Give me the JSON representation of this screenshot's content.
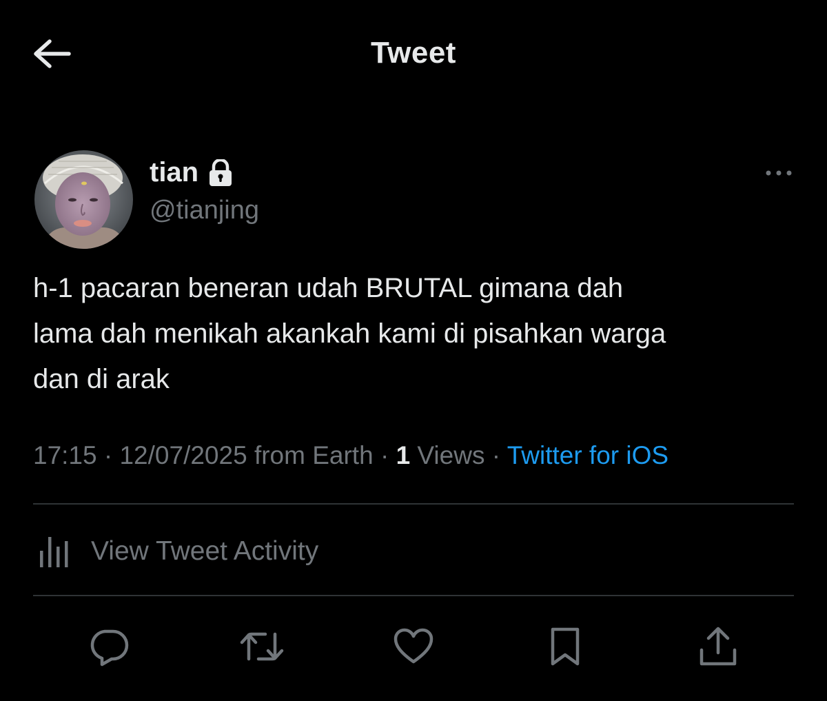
{
  "header": {
    "title": "Tweet",
    "back_icon": "arrow-left-icon"
  },
  "author": {
    "display_name": "tian",
    "handle": "@tianjing",
    "protected_icon": "lock-icon",
    "more_icon": "more-horizontal-icon"
  },
  "tweet": {
    "text": "h-1 pacaran beneran udah BRUTAL gimana dah\nlama dah menikah akankah kami di pisahkan warga\ndan di arak",
    "time": "17:15",
    "date": "12/07/2025",
    "location_text": "from Earth",
    "separator": "·",
    "views_count": "1",
    "views_label": "Views",
    "source": "Twitter for iOS"
  },
  "activity": {
    "label": "View Tweet Activity",
    "icon": "bar-chart-icon"
  },
  "actions": {
    "reply_icon": "reply-icon",
    "retweet_icon": "retweet-icon",
    "like_icon": "heart-icon",
    "bookmark_icon": "bookmark-icon",
    "share_icon": "share-icon"
  },
  "colors": {
    "background": "#000000",
    "text_primary": "#e7e9ea",
    "text_secondary": "#71767b",
    "accent": "#1d9bf0",
    "divider": "#2f3336"
  }
}
